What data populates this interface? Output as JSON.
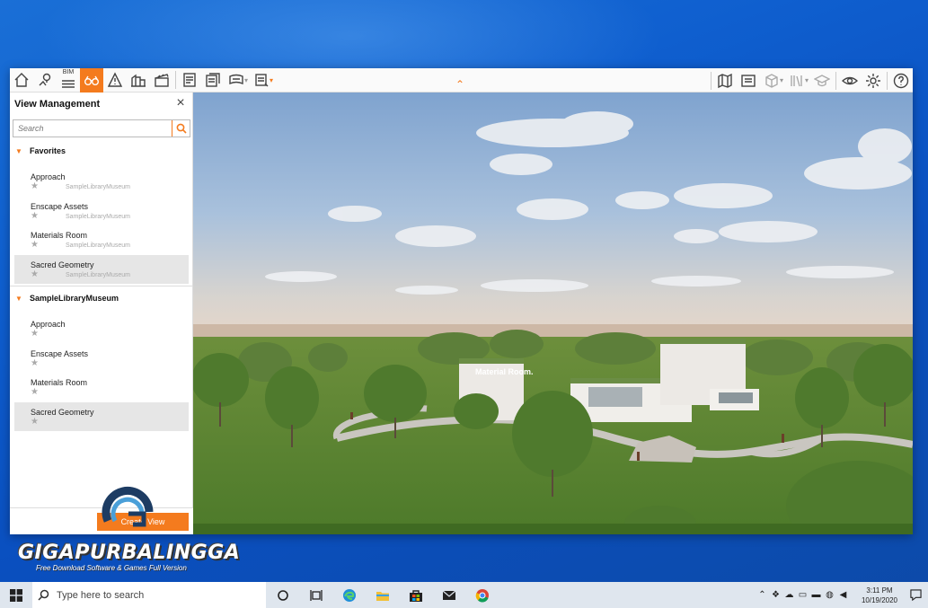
{
  "toolbar": {
    "bim_label": "BIM",
    "collapse_icon": "chevron-up-icon"
  },
  "panel": {
    "title": "View Management",
    "search_placeholder": "Search",
    "groups": [
      {
        "label": "Favorites",
        "items": [
          {
            "name": "Approach",
            "project": "SampleLibraryMuseum"
          },
          {
            "name": "Enscape Assets",
            "project": "SampleLibraryMuseum"
          },
          {
            "name": "Materials Room",
            "project": "SampleLibraryMuseum"
          },
          {
            "name": "Sacred Geometry",
            "project": "SampleLibraryMuseum"
          }
        ]
      },
      {
        "label": "SampleLibraryMuseum",
        "items": [
          {
            "name": "Approach"
          },
          {
            "name": "Enscape Assets"
          },
          {
            "name": "Materials Room"
          },
          {
            "name": "Sacred Geometry"
          }
        ]
      }
    ],
    "create_button": "Create View"
  },
  "viewport": {
    "building_sign": "Material Room."
  },
  "watermark": {
    "title": "GIGAPURBALINGGA",
    "subtitle": "Free Download Software & Games Full Version"
  },
  "taskbar": {
    "search_placeholder": "Type here to search",
    "time": "3:11 PM",
    "date": "10/19/2020"
  },
  "colors": {
    "accent": "#f47b1e",
    "selected_row": "#e6e6e6"
  }
}
